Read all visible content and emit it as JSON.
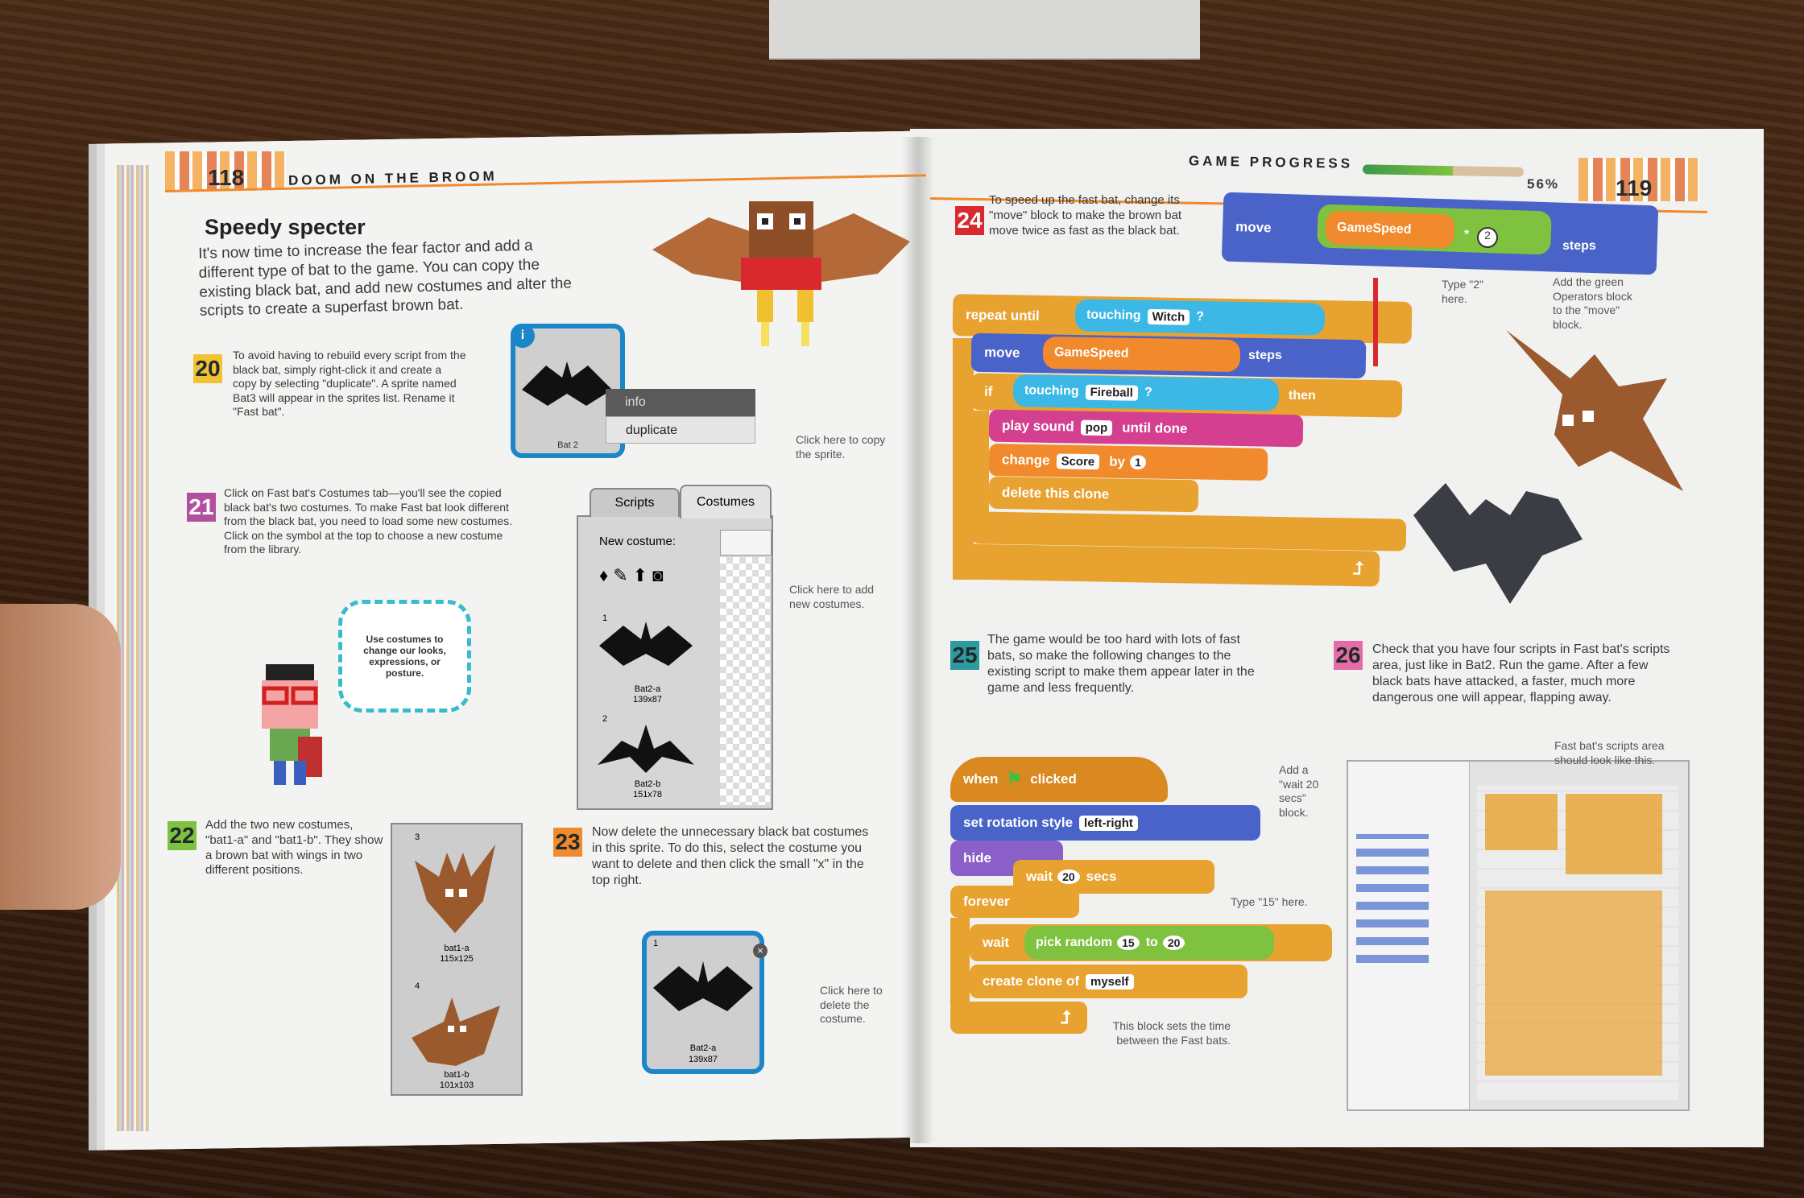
{
  "left_page": {
    "page_number": "118",
    "running_head": "DOOM ON THE BROOM",
    "section_title": "Speedy specter",
    "intro": "It's now time to increase the fear factor and add a different type of bat to the game. You can copy the existing black bat, and add new costumes and alter the scripts to create a superfast brown bat.",
    "step20": {
      "num": "20",
      "text": "To avoid having to rebuild every script from the black bat, simply right-click it and create a copy by selecting \"duplicate\". A sprite named Bat3 will appear in the sprites list. Rename it \"Fast bat\"."
    },
    "sprite_card": {
      "name": "Bat 2",
      "menu_info": "info",
      "menu_duplicate": "duplicate",
      "note": "Click here to copy the sprite."
    },
    "step21": {
      "num": "21",
      "text": "Click on Fast bat's Costumes tab—you'll see the copied black bat's two costumes. To make Fast bat look different from the black bat, you need to load some new costumes. Click on the symbol at the top to choose a new costume from the library."
    },
    "costume_panel": {
      "tab_scripts": "Scripts",
      "tab_costumes": "Costumes",
      "new_costume": "New costume:",
      "costume1_index": "1",
      "costume1_name": "Bat2-a",
      "costume1_size": "139x87",
      "costume2_index": "2",
      "costume2_name": "Bat2-b",
      "costume2_size": "151x78",
      "note": "Click here to add new costumes."
    },
    "bubble_text": "Use costumes to change our looks, expressions, or posture.",
    "step22": {
      "num": "22",
      "text": "Add the two new costumes, \"bat1-a\" and \"bat1-b\". They show a brown bat with wings in two different positions."
    },
    "brown_costumes": {
      "c3_index": "3",
      "c3_name": "bat1-a",
      "c3_size": "115x125",
      "c4_index": "4",
      "c4_name": "bat1-b",
      "c4_size": "101x103"
    },
    "step23": {
      "num": "23",
      "text": "Now delete the unnecessary black bat costumes in this sprite. To do this, select the costume you want to delete and then click the small \"x\" in the top right."
    },
    "delete_card": {
      "index": "1",
      "name": "Bat2-a",
      "size": "139x87",
      "note": "Click here to delete the costume."
    }
  },
  "right_page": {
    "page_number": "119",
    "running_head": "GAME PROGRESS",
    "progress_label": "56%",
    "progress": 0.56,
    "step24": {
      "num": "24",
      "text": "To speed up the fast bat, change its \"move\" block to make the brown bat move twice as fast as the black bat."
    },
    "move_block": {
      "move": "move",
      "var": "GameSpeed",
      "op": "*",
      "val": "2",
      "steps": "steps"
    },
    "note_type2": "Type \"2\" here.",
    "note_green": "Add the green Operators block to the \"move\" block.",
    "script1": {
      "repeat_until": "repeat until",
      "touching1": "touching",
      "witch": "Witch",
      "q1": "?",
      "move": "move",
      "gamespeed": "GameSpeed",
      "steps": "steps",
      "if": "if",
      "touching2": "touching",
      "fireball": "Fireball",
      "q2": "?",
      "then": "then",
      "play_sound": "play sound",
      "pop": "pop",
      "until_done": "until done",
      "change": "change",
      "score": "Score",
      "by": "by",
      "one": "1",
      "delete": "delete this clone"
    },
    "step25": {
      "num": "25",
      "text": "The game would be too hard with lots of fast bats, so make the following changes to the existing script to make them appear later in the game and less frequently."
    },
    "step26": {
      "num": "26",
      "text": "Check that you have four scripts in Fast bat's scripts area, just like in Bat2. Run the game. After a few black bats have attacked, a faster, much more dangerous one will appear, flapping away."
    },
    "script2": {
      "when": "when",
      "clicked": "clicked",
      "set_rotation": "set rotation style",
      "left_right": "left-right",
      "hide": "hide",
      "wait": "wait",
      "twenty": "20",
      "secs": "secs",
      "forever": "forever",
      "wait2": "wait",
      "pick_random": "pick random",
      "fifteen": "15",
      "to": "to",
      "twenty2": "20",
      "create_clone": "create clone of",
      "myself": "myself"
    },
    "note_wait": "Add a \"wait 20 secs\" block.",
    "note_15": "Type \"15\" here.",
    "note_time": "This block sets the time between the Fast bats.",
    "note_area": "Fast bat's scripts area should look like this."
  },
  "colors": {
    "orange": "#f08a2c",
    "blue": "#4a63c8",
    "cyan": "#3bb8e6",
    "green": "#7fc23f",
    "magenta": "#d4408f",
    "teal": "#2e9aa0",
    "yellow": "#e8b830"
  }
}
